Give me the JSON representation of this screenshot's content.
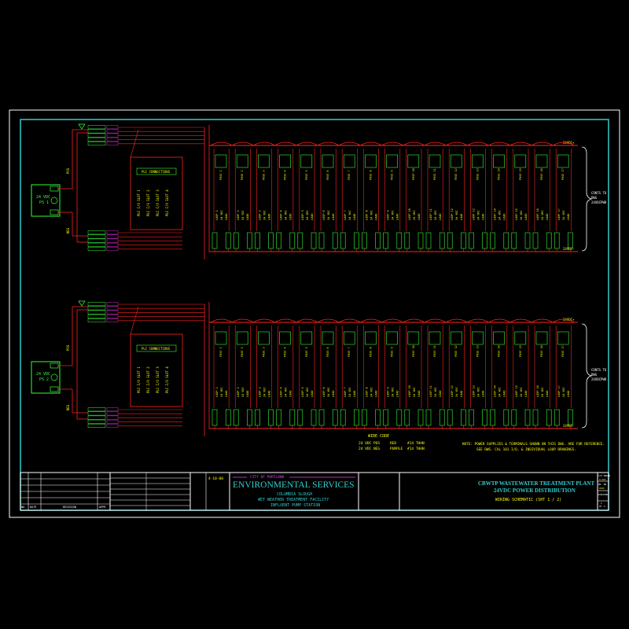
{
  "colors": {
    "background": "#000000",
    "border": "#33cccc",
    "wire": "#ff2020",
    "terminal": "#33ff33",
    "text": "#ffff00",
    "magenta": "#ff33ff",
    "white": "#ffffff"
  },
  "power_supplies": [
    {
      "label": "24 VDC",
      "sub": "PS 1",
      "pos_label": "POS",
      "neg_label": "NEG"
    },
    {
      "label": "24 VDC",
      "sub": "PS 2",
      "pos_label": "POS",
      "neg_label": "NEG"
    }
  ],
  "plc_connections_label": "PLC CONNECTIONS",
  "bus_labels": {
    "top": "24VDC+",
    "bottom": "24VDC-"
  },
  "right_note": [
    "CONTS TO",
    "DWG",
    "24VDCPWR"
  ],
  "wire_code": {
    "title": "WIRE CODE",
    "rows": [
      {
        "desc": "24 VDC POS",
        "color": "RED",
        "wire": "#14 THHN"
      },
      {
        "desc": "24 VDC NEG",
        "color": "PURPLE",
        "wire": "#14 THHN"
      }
    ]
  },
  "note": [
    "NOTE:  POWER SUPPLIES & TERMINALS SHOWN ON THIS DWG. ARE FOR REFERENCE.",
    "SEE DWG. CAL 101 I/O, & INDIVIDUAL LOOP DRAWINGS."
  ],
  "title_block": {
    "agency_top": "CITY OF PORTLAND",
    "agency": "ENVIRONMENTAL SERVICES",
    "project_lines": [
      "COLUMBIA SLOUGH",
      "WET WEATHER TREATMENT FACILITY",
      "INFLUENT PUMP STATION"
    ],
    "plant": "CBWTP WASTEWATER TREATMENT PLANT",
    "system": "24VDC POWER DISTRIBUTION",
    "sheet_desc": "WIRING SCHEMATIC (SHT 1 / 2)",
    "date": "4-10-00",
    "revisions_label": "REVISION",
    "no_label": "NO.",
    "date_label": "DATE",
    "appr_label": "APPR",
    "right_cells": [
      "I/O ORDER",
      "X-XXX",
      "DR. NO.",
      "XXXX",
      "24VDCPWR",
      "1",
      "OF",
      "2"
    ]
  }
}
